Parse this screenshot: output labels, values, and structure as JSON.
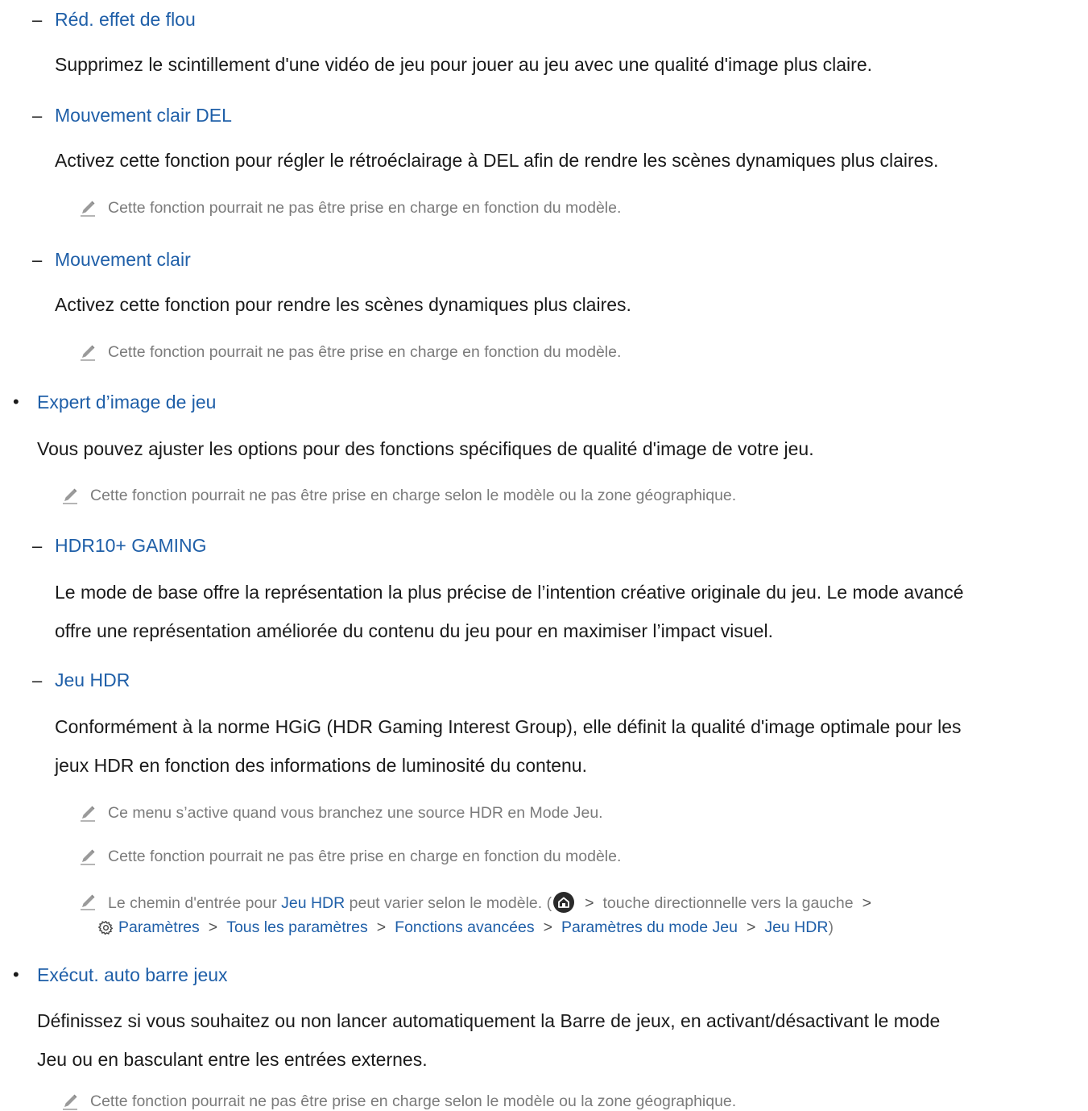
{
  "items": {
    "flou": {
      "marker": "–",
      "title": "Réd. effet de flou",
      "body": "Supprimez le scintillement d'une vidéo de jeu pour jouer au jeu avec une qualité d'image plus claire."
    },
    "del": {
      "marker": "–",
      "title": "Mouvement clair DEL",
      "body": "Activez cette fonction pour régler le rétroéclairage à DEL afin de rendre les scènes dynamiques plus claires.",
      "note": "Cette fonction pourrait ne pas être prise en charge en fonction du modèle."
    },
    "clair": {
      "marker": "–",
      "title": "Mouvement clair",
      "body": "Activez cette fonction pour rendre les scènes dynamiques plus claires.",
      "note": "Cette fonction pourrait ne pas être prise en charge en fonction du modèle."
    },
    "expert": {
      "marker": "•",
      "title": "Expert d’image de jeu",
      "body": "Vous pouvez ajuster les options pour des fonctions spécifiques de qualité d'image de votre jeu.",
      "note": "Cette fonction pourrait ne pas être prise en charge selon le modèle ou la zone géographique."
    },
    "hdr10": {
      "marker": "–",
      "title": "HDR10+ GAMING",
      "body_line1": "Le mode de base offre la représentation la plus précise de l’intention créative originale du jeu. Le mode avancé",
      "body_line2": "offre une représentation améliorée du contenu du jeu pour en maximiser l’impact visuel."
    },
    "jeuhdr": {
      "marker": "–",
      "title": "Jeu HDR",
      "body_line1": "Conformément à la norme HGiG (HDR Gaming Interest Group), elle définit la qualité d'image optimale pour les",
      "body_line2": "jeux HDR en fonction des informations de luminosité du contenu.",
      "note1": "Ce menu s’active quand vous branchez une source HDR en Mode Jeu.",
      "note2": "Cette fonction pourrait ne pas être prise en charge en fonction du modèle.",
      "note3": {
        "prefix": "Le chemin d'entrée pour ",
        "link": "Jeu HDR",
        "mid": " peut varier selon le modèle. (",
        "sep": ">",
        "direction": "touche directionnelle vers la gauche",
        "path": [
          "Paramètres",
          "Tous les paramètres",
          "Fonctions avancées",
          "Paramètres du mode Jeu",
          "Jeu HDR"
        ],
        "close": ")"
      }
    },
    "barre": {
      "marker": "•",
      "title": "Exécut. auto barre jeux",
      "body_line1": "Définissez si vous souhaitez ou non lancer automatiquement la Barre de jeux, en activant/désactivant le mode",
      "body_line2": "Jeu ou en basculant entre les entrées externes.",
      "note": "Cette fonction pourrait ne pas être prise en charge selon le modèle ou la zone géographique."
    }
  },
  "icons": {
    "note": "pencil-icon",
    "home": "home-icon",
    "settings": "gear-icon"
  },
  "colors": {
    "heading": "#1f5fa8",
    "body": "#1a1a1a",
    "note": "#7b7b7b"
  }
}
